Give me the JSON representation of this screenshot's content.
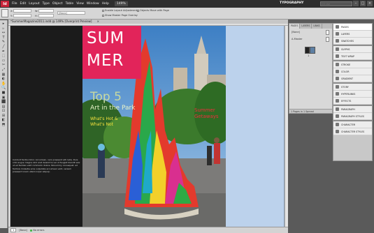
{
  "menubar": {
    "logo": "Id",
    "items": [
      "File",
      "Edit",
      "Layout",
      "Type",
      "Object",
      "Table",
      "View",
      "Window",
      "Help"
    ],
    "zoom": "149%",
    "workspace": "TYPOGRAPHY",
    "search_placeholder": "CS Live"
  },
  "controlbar": {
    "x_label": "X:",
    "y_label": "Y:",
    "w_label": "W:",
    "h_label": "H:",
    "style_value": "[Basic]",
    "enable_layout_adjustment": "Enable Layout Adjustment",
    "show_master_overlay": "Show Master Page Overlay",
    "objects_move_with_page": "Objects Move with Page"
  },
  "tools": [
    "▸",
    "▹",
    "↔",
    "T",
    "✎",
    "╱",
    "✒",
    "⬚",
    "▭",
    "✂",
    "⤢",
    "▦",
    "◐",
    "✋",
    "🔍",
    "■",
    "▣",
    "⬛",
    "▤",
    "⊡",
    "⊞",
    "◧",
    "⬒",
    "▥",
    "◫",
    "⬓",
    "▧",
    "◩",
    "⊠",
    "⬕",
    "⊟",
    "▨"
  ],
  "document": {
    "title": "*SummerMagazine2011.indd @ 149% [Overprint Preview]",
    "close": "×"
  },
  "left_page": {
    "body_text": "Incidunt facilisi dolor. Accumsan, vero praesent elit nulla. Duis odio augue magna zzril erat delenit te vel ut feugiat blandit wisi ut ad facilisis velit commodo dolore. Nonummy consequat, ad facilisis molestie eros vulputate accumsan velit, veniam praesent lorem ullamcorper aliquip."
  },
  "cover": {
    "title_line1": "SUM",
    "title_line2": "MER",
    "top5": "Top 5",
    "art_in_park": "Art in the Park",
    "hot_line1": "What's Hot &",
    "hot_line2": "What's Not",
    "getaways_line1": "Summer",
    "getaways_line2": "Getaways",
    "colors": {
      "title_box": "#e2245a",
      "sky": "#4f8fcf",
      "trees": "#2f6a26"
    }
  },
  "status": {
    "page": "1",
    "master": "[Basic]",
    "preflight": "No errors"
  },
  "pages_panel": {
    "tabs": [
      "PAGES",
      "LAYERS",
      "LINKS"
    ],
    "none_label": "[None]",
    "master_label": "A-Master",
    "page_number": "1",
    "footer": "1 Pages in 1 Spread"
  },
  "dock": {
    "groups": [
      [
        "PAGES",
        "LAYERS",
        "SWATCHES"
      ],
      [
        "GLYPHS",
        "TEXT WRAP"
      ],
      [
        "STROKE",
        "COLOR",
        "GRADIENT"
      ],
      [
        "STORY",
        "HYPERLINKS",
        "EFFECTS"
      ],
      [
        "PARAGRAPH",
        "PARAGRAPH STYLES"
      ],
      [
        "CHARACTER",
        "CHARACTER STYLES"
      ]
    ]
  }
}
